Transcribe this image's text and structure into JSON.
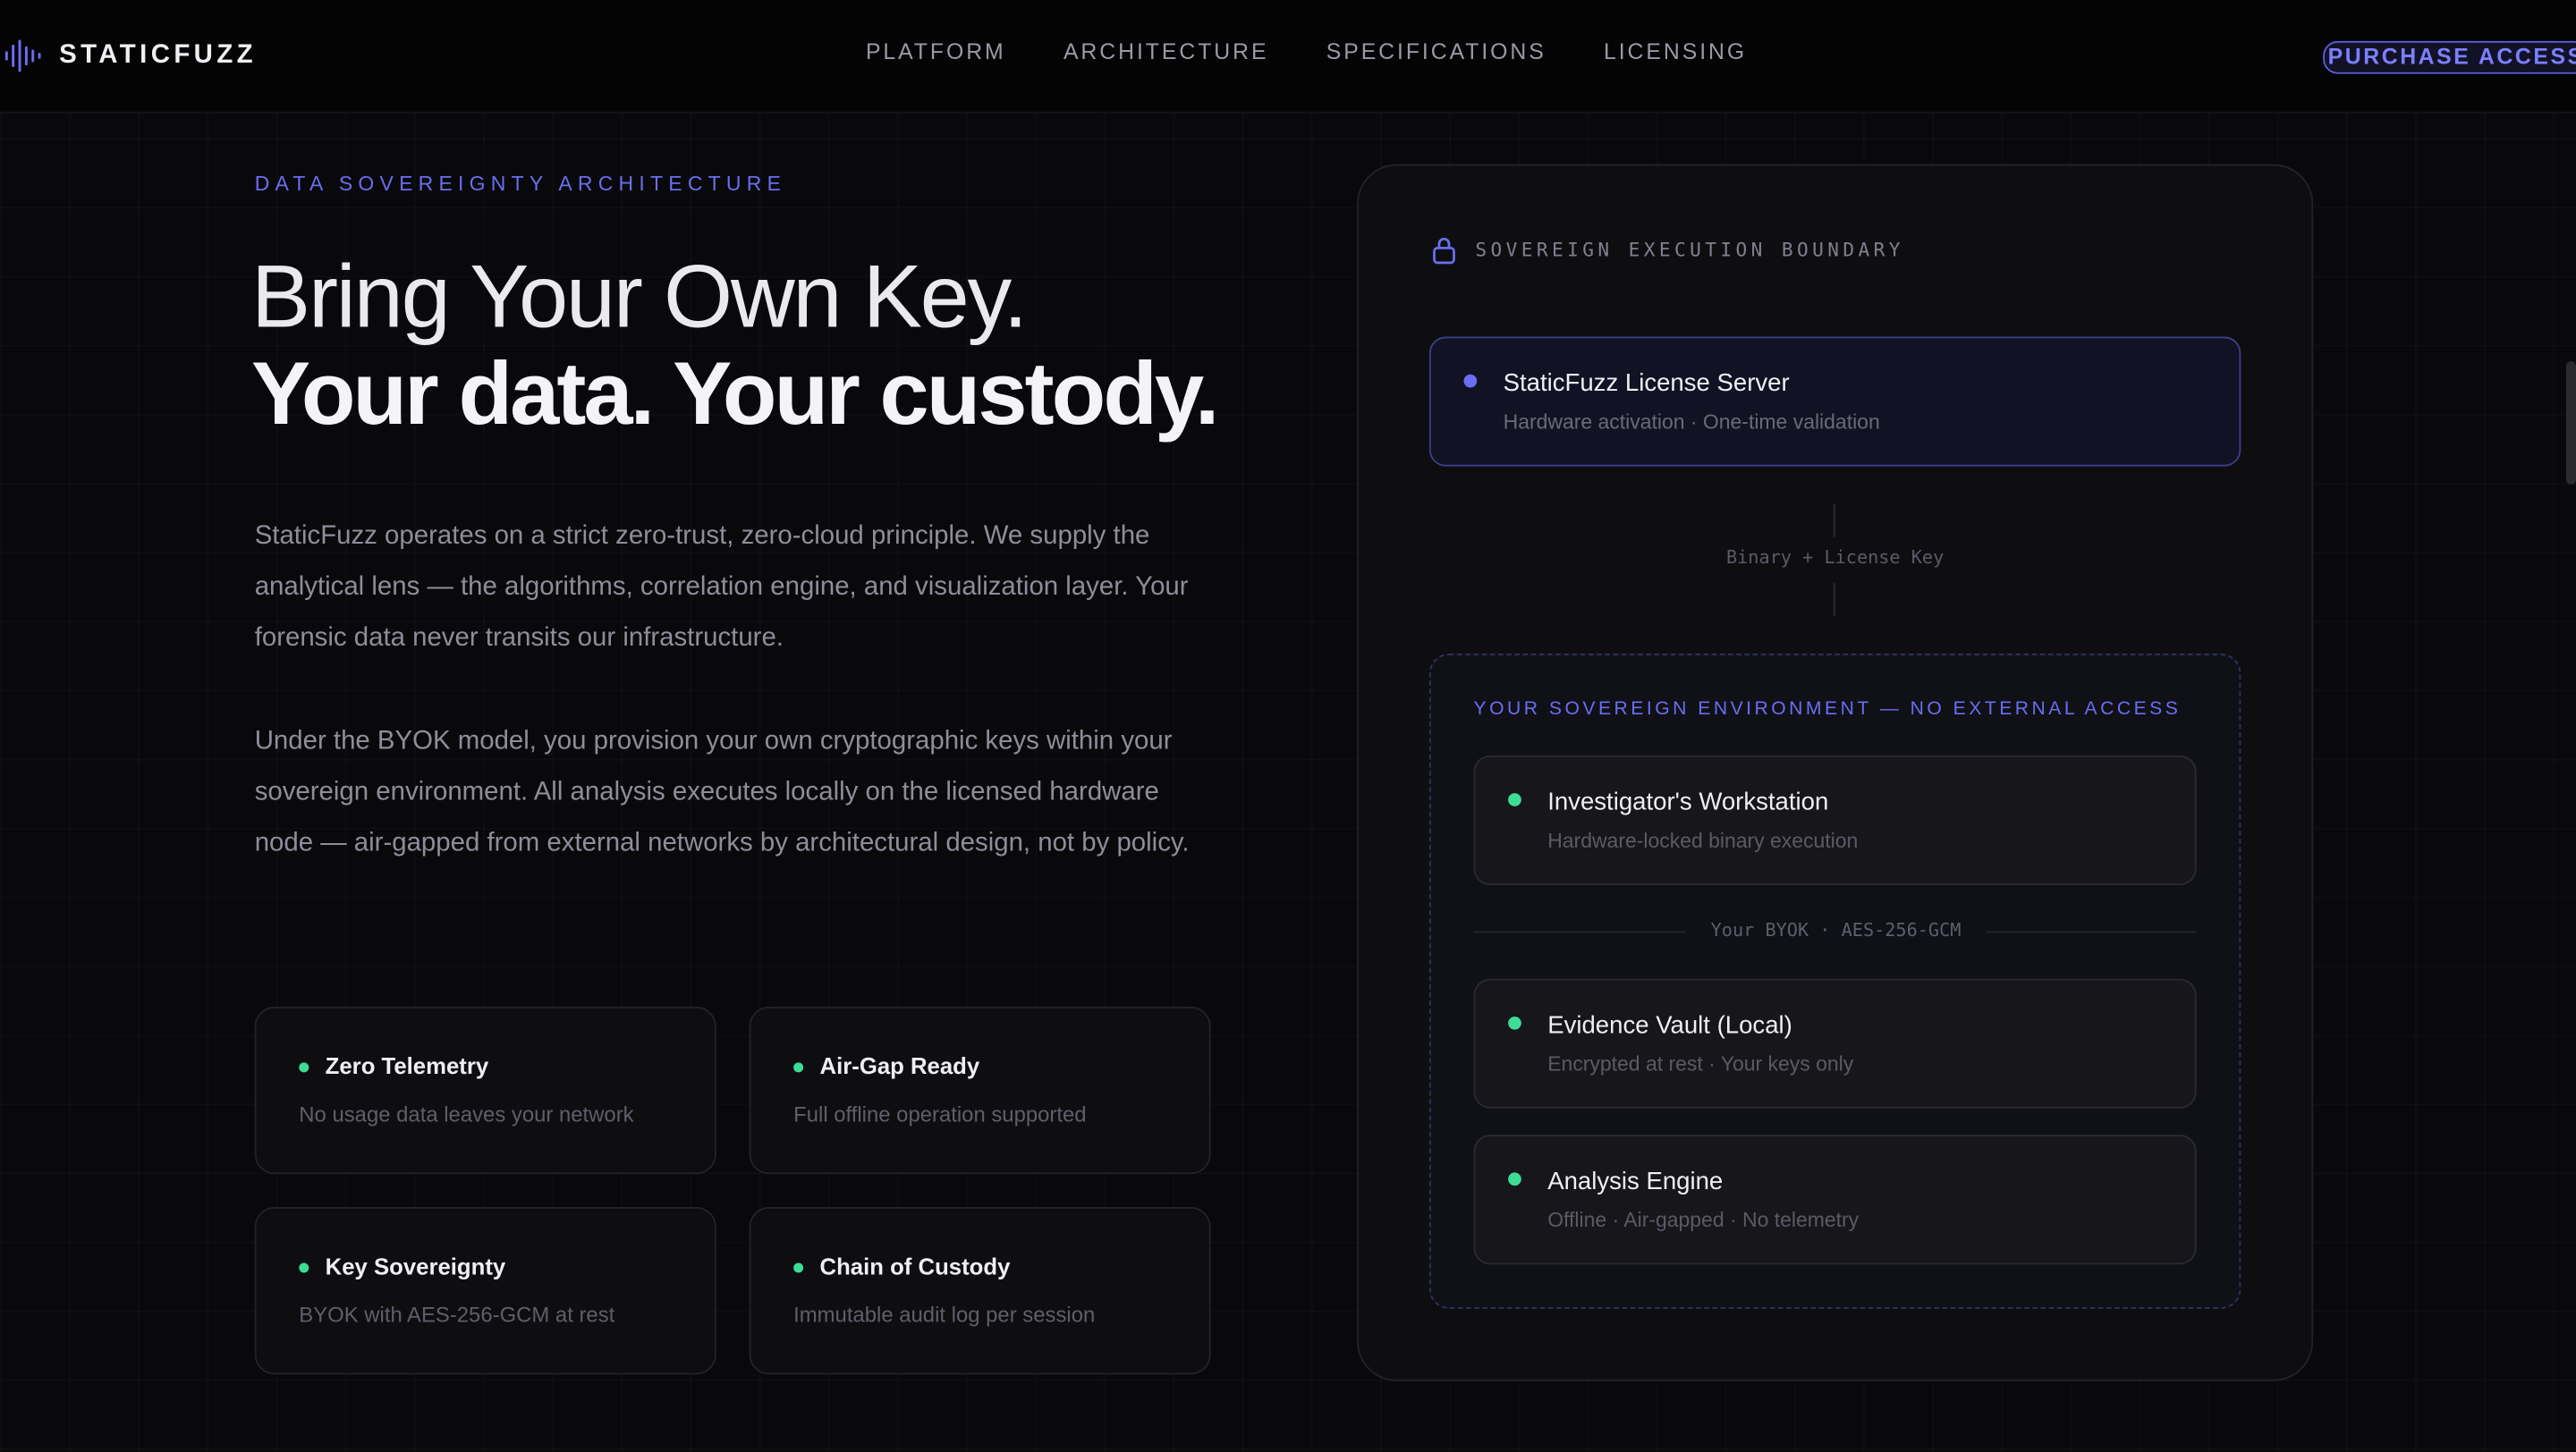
{
  "nav": {
    "brand": "STATICFUZZ",
    "links": [
      "PLATFORM",
      "ARCHITECTURE",
      "SPECIFICATIONS",
      "LICENSING"
    ],
    "cta": "PURCHASE ACCESS"
  },
  "hero": {
    "eyebrow": "DATA SOVEREIGNTY ARCHITECTURE",
    "line1": "Bring Your Own Key.",
    "line2": "Your data. Your custody.",
    "para1": "StaticFuzz operates on a strict zero-trust, zero-cloud principle. We supply the analytical lens — the algorithms, correlation engine, and visualization layer. Your forensic data never transits our infrastructure.",
    "para2": "Under the BYOK model, you provision your own cryptographic keys within your sovereign environment. All analysis executes locally on the licensed hardware node — air-gapped from external networks by architectural design, not by policy."
  },
  "features": [
    {
      "title": "Zero Telemetry",
      "desc": "No usage data leaves your network"
    },
    {
      "title": "Air-Gap Ready",
      "desc": "Full offline operation supported"
    },
    {
      "title": "Key Sovereignty",
      "desc": "BYOK with AES-256-GCM at rest"
    },
    {
      "title": "Chain of Custody",
      "desc": "Immutable audit log per session"
    }
  ],
  "panel": {
    "title": "SOVEREIGN EXECUTION BOUNDARY",
    "server": {
      "title": "StaticFuzz License Server",
      "desc": "Hardware activation · One-time validation"
    },
    "connector": "Binary + License Key",
    "env_label": "YOUR SOVEREIGN ENVIRONMENT — NO EXTERNAL ACCESS",
    "workstation": {
      "title": "Investigator's Workstation",
      "desc": "Hardware-locked binary execution"
    },
    "byok": "Your BYOK · AES-256-GCM",
    "vault": {
      "title": "Evidence Vault (Local)",
      "desc": "Encrypted at rest · Your keys only"
    },
    "engine": {
      "title": "Analysis Engine",
      "desc": "Offline · Air-gapped · No telemetry"
    }
  },
  "colors": {
    "accent": "#6a6ef0",
    "success": "#3ddc97",
    "background": "#09090b"
  },
  "icons": {
    "brand": "waveform-icon",
    "panel": "lock-icon"
  }
}
